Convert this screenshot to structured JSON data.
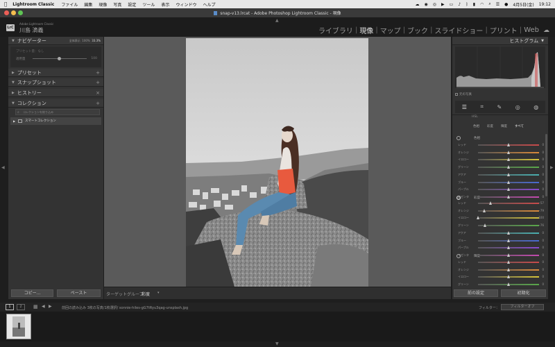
{
  "menubar": {
    "apple": "",
    "app_name": "Lightroom Classic",
    "items": [
      "ファイル",
      "編集",
      "現像",
      "写真",
      "設定",
      "ツール",
      "表示",
      "ウィンドウ",
      "ヘルプ"
    ],
    "date": "4月5日(金)",
    "time": "19:12"
  },
  "window": {
    "title": "snap-v13.lrcat - Adobe Photoshop Lightroom Classic - 現像"
  },
  "identity": {
    "logo": "LrC",
    "small": "Adobe Lightroom Classic",
    "name": "川島 滴義"
  },
  "modules": {
    "items": [
      "ライブラリ",
      "現像",
      "マップ",
      "ブック",
      "スライドショー",
      "プリント",
      "Web"
    ],
    "active": "現像"
  },
  "left_panel": {
    "navigator": "ナビゲーター",
    "nav_fit": "全体表示",
    "nav_zoom1": "100%",
    "nav_zoom2": "33.3%",
    "nav_preset_label": "プリセット量：なし",
    "nav_amount": "適用量",
    "nav_amount_val": "100",
    "presets": "プリセット",
    "snapshots": "スナップショット",
    "history": "ヒストリー",
    "collections": "コレクション",
    "search_placeholder": "コレクションを絞り込み",
    "smart_collection": "スマートコレクション",
    "copy_btn": "コピー...",
    "paste_btn": "ペースト"
  },
  "right_panel": {
    "histogram": "ヒストグラム",
    "original_photo": "元の写真",
    "tabs_partial": "HSL",
    "color_tabs": [
      "色相",
      "彩度",
      "輝度",
      "すべて"
    ],
    "section_hue": "色相",
    "section_sat": "彩度",
    "section_lum": "輝度",
    "colors": [
      "レッド",
      "オレンジ",
      "イエロー",
      "グリーン",
      "アクア",
      "ブルー",
      "パープル",
      "マゼンタ"
    ],
    "hue_values": [
      "0",
      "0",
      "0",
      "0",
      "0",
      "0",
      "0",
      "0"
    ],
    "sat_values": [
      "−57",
      "−79",
      "−100",
      "−76",
      "0",
      "0",
      "0",
      "0"
    ],
    "sat_numbers": [
      -57,
      -79,
      -100,
      -76,
      0,
      0,
      0,
      0
    ],
    "lum_values": [
      "0",
      "0",
      "0",
      "0"
    ],
    "prev_btn": "前の設定",
    "reset_btn": "初期化",
    "slider_colors": [
      "#c94a4a",
      "#d9893a",
      "#d6c43a",
      "#5aa84a",
      "#4ab0b0",
      "#4a6ad0",
      "#8a4ad0",
      "#c44ab0"
    ]
  },
  "toolbar": {
    "target_group": "ターゲットグループ",
    "target_val": "彩度"
  },
  "filmstrip_bar": {
    "page1": "1",
    "page2": "2",
    "info": "前回の読み込み  3枚の写真/1枚選択/ sonnie-hiles-gG7tRyu3qag-unsplash.jpg",
    "filter_label": "フィルター：",
    "filter_val": "フィルターオフ"
  }
}
